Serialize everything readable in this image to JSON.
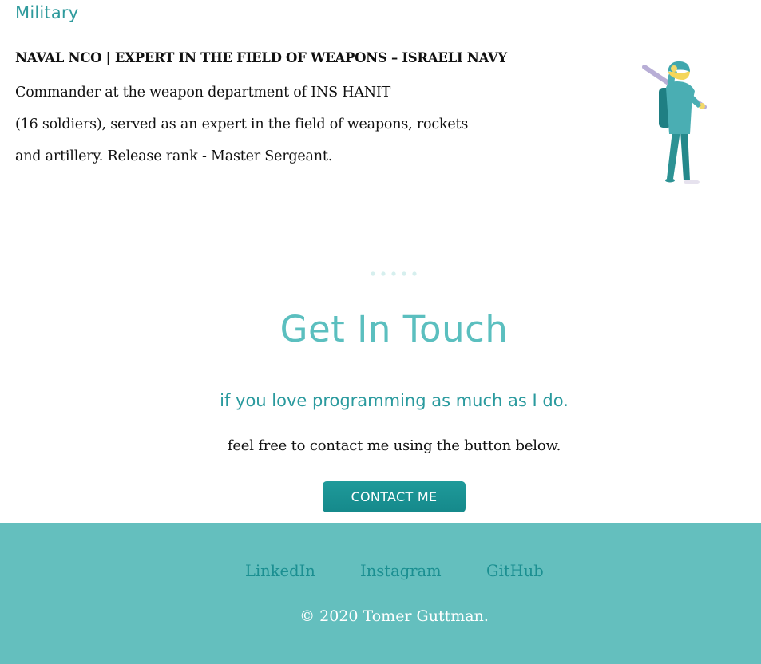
{
  "military": {
    "title": "Military",
    "job_title": "NAVAL NCO | EXPERT IN THE FIELD OF WEAPONS – ISRAELI NAVY",
    "description_lines": [
      "Commander at the weapon department of INS HANIT",
      "(16 soldiers), served as an expert in the field of weapons, rockets",
      "and artillery. Release rank - Master Sergeant."
    ]
  },
  "contact": {
    "title": "Get In Touch",
    "subtitle": "if you love programming as much as I do.",
    "text": "feel free to contact me using the button below.",
    "button_label": "CONTACT ME"
  },
  "footer": {
    "links": [
      "LinkedIn",
      "Instagram",
      "GitHub"
    ],
    "copyright": "© 2020 Tomer Guttman."
  },
  "colors": {
    "accent": "#2e9a9c",
    "heading_teal": "#5bbfbf",
    "button": "#1a9394",
    "footer_bg": "#64bfbe",
    "footer_link": "#1b8f91"
  },
  "icons": {
    "illustration": "soldier-illustration",
    "separator": "dots-separator"
  }
}
